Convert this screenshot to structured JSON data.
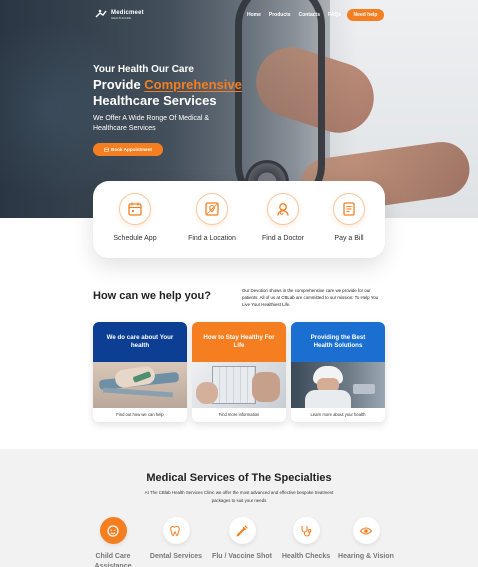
{
  "nav": {
    "logo_name": "Medicmeet",
    "logo_tag": "HEALTHCARE",
    "items": [
      "Home",
      "Products",
      "Contacts",
      "FAQs"
    ],
    "help_button": "Need help"
  },
  "hero": {
    "subtitle": "Your Health Our Care",
    "title_prefix": "Provide ",
    "title_highlight": "Comprehensive",
    "title_line2": "Healthcare Services",
    "description": "We Offer A Wide Ronge Of Medical & Healthcare Services",
    "book_button": "Book Appointment"
  },
  "features": [
    {
      "label": "Schedule App",
      "icon": "calendar-icon"
    },
    {
      "label": "Find a Location",
      "icon": "map-icon"
    },
    {
      "label": "Find a Doctor",
      "icon": "doctor-icon"
    },
    {
      "label": "Pay a Bill",
      "icon": "bill-icon"
    }
  ],
  "help": {
    "title": "How can we help you?",
    "description": "Our Devotion shows in the comprehensive care we provide for our patients. All of us at CBLab are committed to our mission: To Help You Live Your Healthiest Life.",
    "cards": [
      {
        "title": "We do care about Your health",
        "caption": "Find out how we can help",
        "color": "#0c3f94"
      },
      {
        "title": "How to Stay Healthy For Life",
        "caption": "Find more information",
        "color": "#f57e20"
      },
      {
        "title": "Providing the Best Health Solutions",
        "caption": "Learn more about your health",
        "color": "#1a6fd1"
      }
    ]
  },
  "services": {
    "title": "Medical Services of The Specialties",
    "description": "At The CBlab Health Services Clinic we offer the most advanced and effective bespoke treatment packages to suit your needs",
    "items": [
      {
        "label": "Child Care Assistance",
        "icon": "child-icon",
        "active": true
      },
      {
        "label": "Dental Services",
        "icon": "tooth-icon",
        "active": false
      },
      {
        "label": "Flu / Vaccine Shot",
        "icon": "vaccine-icon",
        "active": false
      },
      {
        "label": "Health Checks",
        "icon": "stethoscope-icon",
        "active": false
      },
      {
        "label": "Hearing & Vision",
        "icon": "eye-icon",
        "active": false
      }
    ]
  },
  "colors": {
    "accent": "#f57e20",
    "navy": "#0c3f94",
    "blue": "#1a6fd1"
  }
}
